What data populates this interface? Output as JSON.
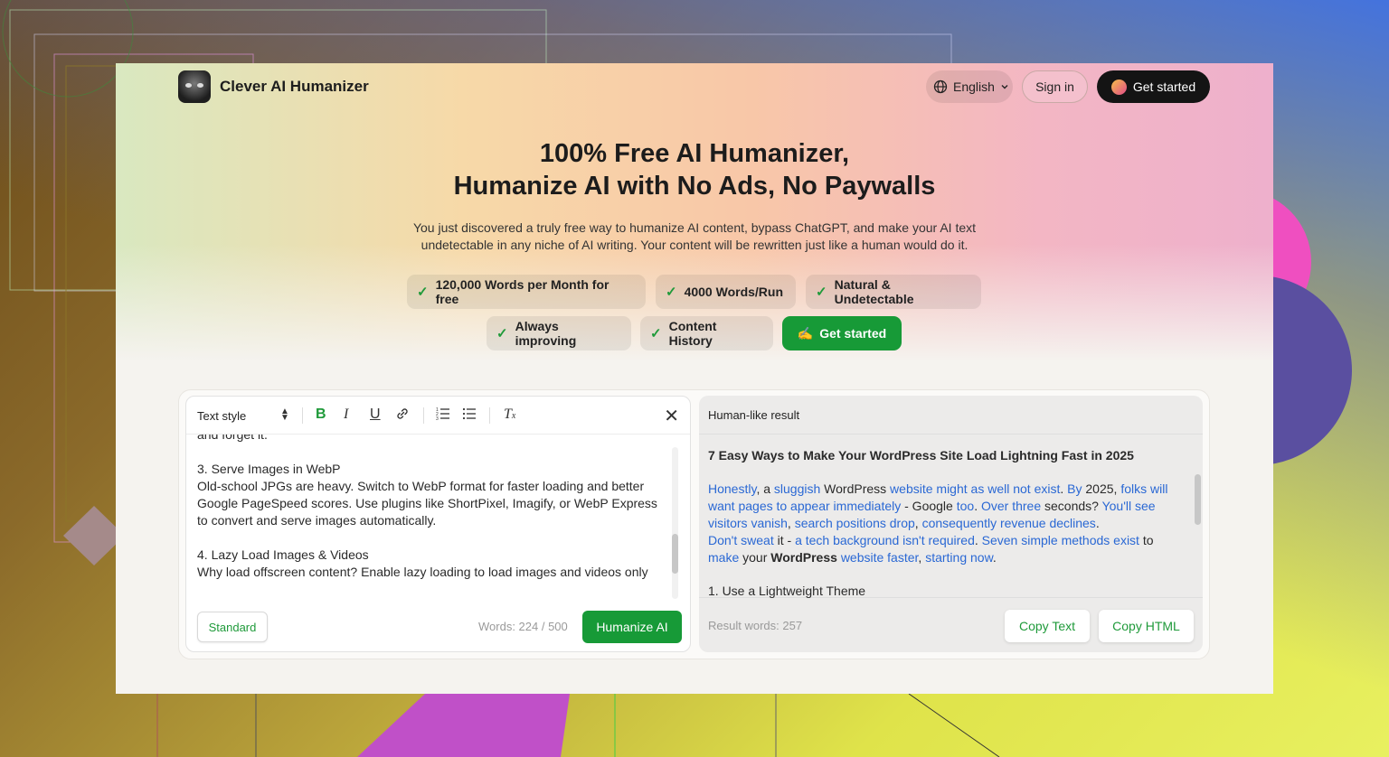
{
  "header": {
    "brand": "Clever AI Humanizer",
    "language": "English",
    "sign_in": "Sign in",
    "get_started": "Get started"
  },
  "hero": {
    "title_line1": "100% Free AI Humanizer,",
    "title_line2": "Humanize AI with No Ads, No Paywalls",
    "subtitle_line1": "You just discovered a truly free way to humanize AI content, bypass ChatGPT, and make your AI text",
    "subtitle_line2": "undetectable in any niche of AI writing. Your content will be rewritten just like a human would do it."
  },
  "features": [
    "120,000 Words per Month for free",
    "4000 Words/Run",
    "Natural & Undetectable",
    "Always improving",
    "Content History"
  ],
  "features_cta": "Get started",
  "editor": {
    "text_style": "Text style",
    "lines": [
      "and forget it.",
      "",
      "3. Serve Images in WebP",
      "Old-school JPGs are heavy. Switch to WebP format for faster loading and better",
      "Google PageSpeed scores. Use plugins like ShortPixel, Imagify, or WebP Express",
      "to convert and serve images automatically.",
      "",
      "4. Lazy Load Images & Videos",
      "Why load offscreen content? Enable lazy loading to load images and videos only"
    ],
    "mode_button": "Standard",
    "word_count": "Words: 224 / 500",
    "humanize_button": "Humanize AI"
  },
  "result": {
    "heading": "Human-like result",
    "title": "7 Easy Ways to Make Your WordPress Site Load Lightning Fast in 2025",
    "list_item": "1. Use a Lightweight Theme",
    "word_count": "Result words: 257",
    "copy_text": "Copy Text",
    "copy_html": "Copy HTML"
  },
  "colors": {
    "accent_green": "#179a37",
    "highlight_blue": "#2a68d4"
  }
}
